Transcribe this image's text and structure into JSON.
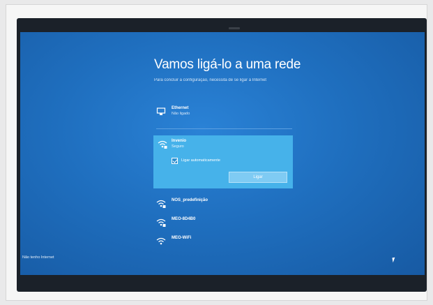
{
  "screen": {
    "title": "Vamos ligá-lo a uma rede",
    "subtitle": "Para concluir a configuração, necessita de se ligar à Internet"
  },
  "networks": [
    {
      "name": "Ethernet",
      "status": "Não ligado",
      "icon": "ethernet-icon"
    },
    {
      "name": "Invenio",
      "status": "Seguro",
      "icon": "wifi-secure-icon",
      "selected": true,
      "auto_label": "Ligar automaticamente",
      "auto_checked": true,
      "connect_label": "Ligar"
    },
    {
      "name": "NOS_predefinição",
      "icon": "wifi-secure-icon"
    },
    {
      "name": "MEO-8D4B0",
      "icon": "wifi-secure-icon"
    },
    {
      "name": "MEO-WiFi",
      "icon": "wifi-icon"
    }
  ],
  "skip_label": "Não tenho Internet",
  "colors": {
    "background": "#1f6fbf",
    "selected": "#46b2ea",
    "button": "#7fcbf3"
  }
}
